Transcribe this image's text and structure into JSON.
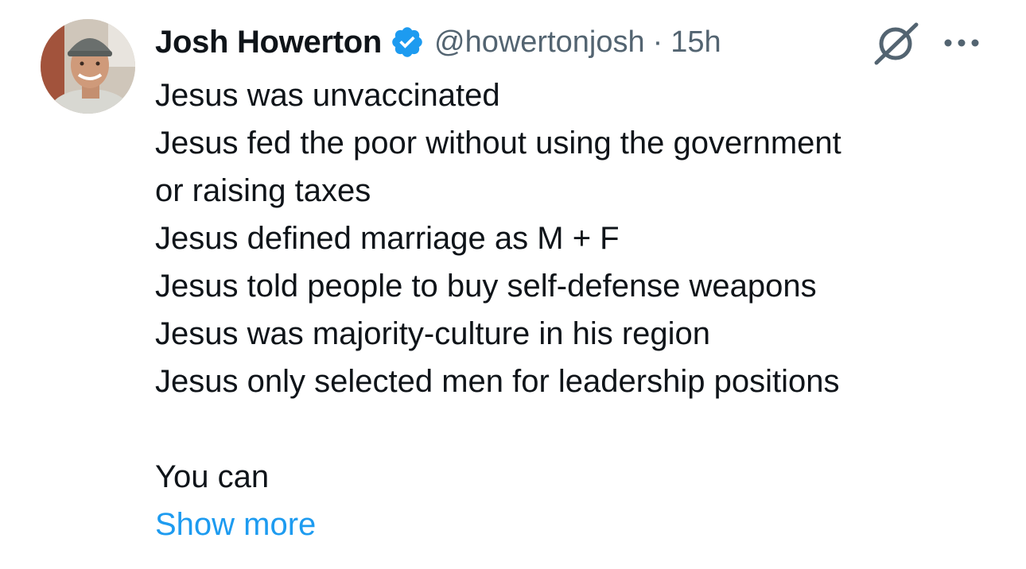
{
  "author": {
    "display_name": "Josh Howerton",
    "handle": "@howertonjosh",
    "separator": "·",
    "time": "15h",
    "verified": true,
    "avatar_icon": "avatar-photo"
  },
  "icons": {
    "verified": "verified-badge-icon",
    "grok": "grok-icon",
    "more": "more-options-icon"
  },
  "colors": {
    "verified_blue": "#1d9bf0",
    "link_blue": "#1d9bf0",
    "secondary_text": "#536471",
    "primary_text": "#0f1419"
  },
  "tweet": {
    "lines": [
      "Jesus was unvaccinated",
      "Jesus fed the poor without using the government",
      "or raising taxes",
      "Jesus defined marriage as M + F",
      "Jesus told people to buy self-defense weapons",
      "Jesus was majority-culture in his region",
      "Jesus only selected men for leadership positions"
    ],
    "after_break": "You can",
    "show_more": "Show more"
  }
}
